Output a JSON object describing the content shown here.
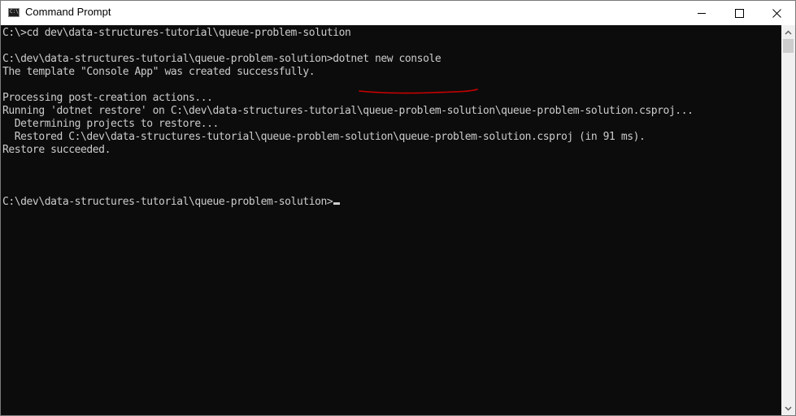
{
  "window": {
    "title": "Command Prompt",
    "icon": "cmd-icon",
    "icon_text": "C:\\",
    "controls": {
      "minimize": "minimize-icon",
      "maximize": "maximize-icon",
      "close": "close-icon",
      "close_glyph": "✕"
    }
  },
  "console": {
    "lines": [
      "C:\\>cd dev\\data-structures-tutorial\\queue-problem-solution",
      "",
      "C:\\dev\\data-structures-tutorial\\queue-problem-solution>dotnet new console",
      "The template \"Console App\" was created successfully.",
      "",
      "Processing post-creation actions...",
      "Running 'dotnet restore' on C:\\dev\\data-structures-tutorial\\queue-problem-solution\\queue-problem-solution.csproj...",
      "  Determining projects to restore...",
      "  Restored C:\\dev\\data-structures-tutorial\\queue-problem-solution\\queue-problem-solution.csproj (in 91 ms).",
      "Restore succeeded.",
      "",
      "",
      "",
      "C:\\dev\\data-structures-tutorial\\queue-problem-solution>"
    ],
    "annotation": {
      "underlined_text": "dotnet new console",
      "color": "#cc0000"
    }
  },
  "scrollbar": {
    "up_glyph": "▲",
    "down_glyph": "▼"
  },
  "colors": {
    "background": "#0c0c0c",
    "foreground": "#cccccc",
    "titlebar": "#ffffff"
  }
}
